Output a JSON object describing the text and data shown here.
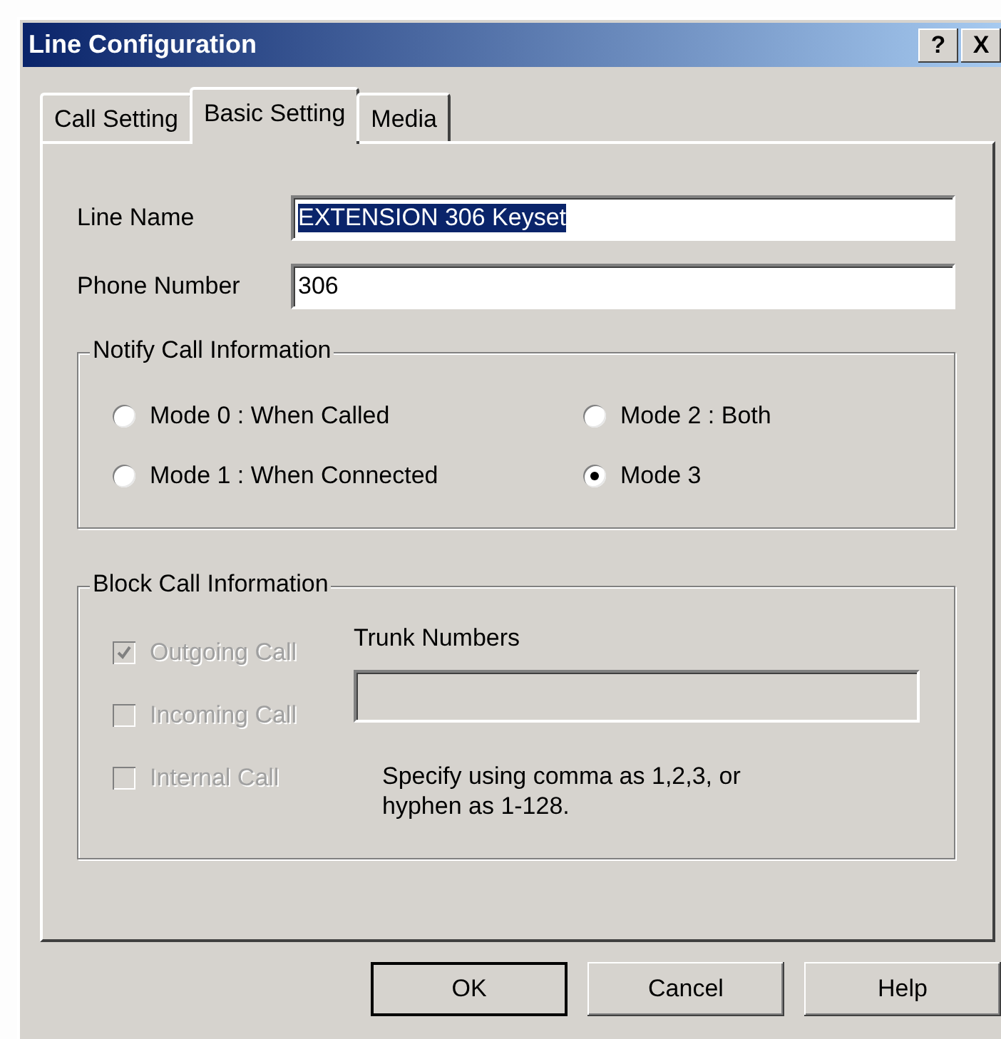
{
  "window": {
    "title": "Line Configuration",
    "title_buttons": [
      "?",
      "X"
    ]
  },
  "tabs": [
    {
      "label": "Call Setting",
      "selected": false
    },
    {
      "label": "Basic Setting",
      "selected": true
    },
    {
      "label": "Media",
      "selected": false
    }
  ],
  "fields": [
    {
      "label": "Line Name",
      "value": "EXTENSION 306 Keyset",
      "highlighted": true
    },
    {
      "label": "Phone Number",
      "value": "306",
      "highlighted": false
    }
  ],
  "notify_group": {
    "title": "Notify Call Information",
    "options": [
      {
        "label": "Mode 0 : When Called",
        "selected": false
      },
      {
        "label": "Mode 2 : Both",
        "selected": false
      },
      {
        "label": "Mode 1 : When Connected",
        "selected": false
      },
      {
        "label": "Mode 3",
        "selected": true
      }
    ]
  },
  "block_group": {
    "title": "Block Call Information",
    "checkboxes": [
      {
        "label": "Outgoing Call",
        "checked": true,
        "disabled": true
      },
      {
        "label": "Incoming Call",
        "checked": false,
        "disabled": true
      },
      {
        "label": "Internal Call",
        "checked": false,
        "disabled": true
      }
    ],
    "trunk_label": "Trunk Numbers",
    "trunk_field": {
      "disabled": true
    },
    "hint": "Specify using comma as 1,2,3, or hyphen as 1-128."
  },
  "buttons": [
    {
      "label": "OK",
      "default": true
    },
    {
      "label": "Cancel",
      "default": false
    },
    {
      "label": "Help",
      "default": false
    }
  ]
}
